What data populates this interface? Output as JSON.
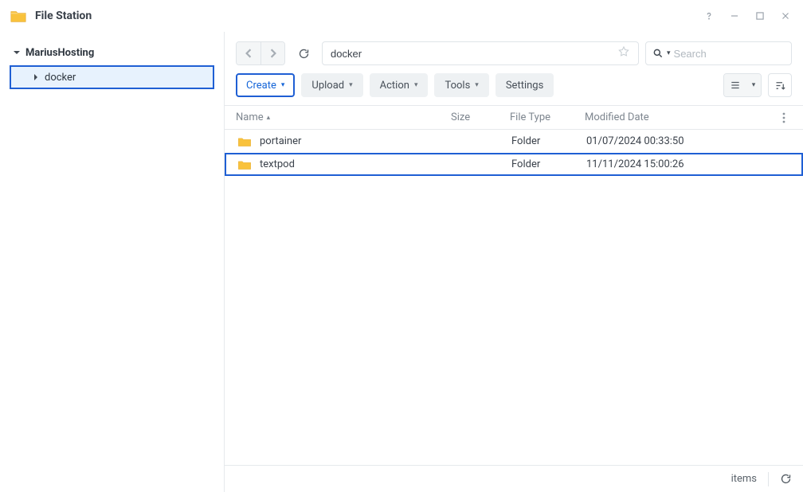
{
  "window": {
    "title": "File Station"
  },
  "sidebar": {
    "root": {
      "label": "MariusHosting"
    },
    "children": [
      {
        "label": "docker"
      }
    ]
  },
  "toolbar": {
    "path_value": "docker",
    "search_placeholder": "Search",
    "buttons": {
      "create": "Create",
      "upload": "Upload",
      "action": "Action",
      "tools": "Tools",
      "settings": "Settings"
    }
  },
  "table": {
    "columns": {
      "name": "Name",
      "size": "Size",
      "type": "File Type",
      "modified": "Modified Date"
    },
    "rows": [
      {
        "name": "portainer",
        "size": "",
        "type": "Folder",
        "modified": "01/07/2024 00:33:50",
        "selected": false
      },
      {
        "name": "textpod",
        "size": "",
        "type": "Folder",
        "modified": "11/11/2024 15:00:26",
        "selected": true
      }
    ]
  },
  "footer": {
    "items_label": "items"
  }
}
